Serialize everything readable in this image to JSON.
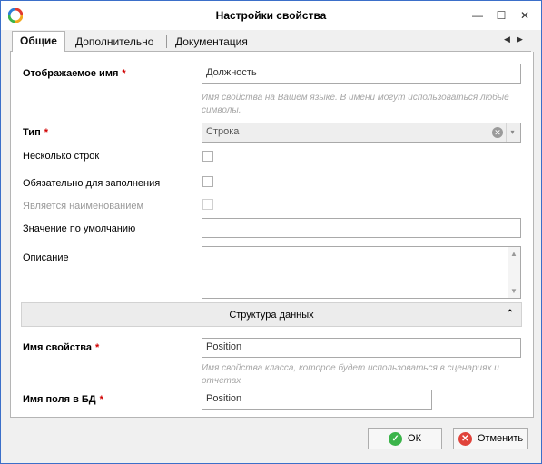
{
  "window": {
    "title": "Настройки свойства",
    "controls": {
      "minimize": "—",
      "maximize": "☐",
      "close": "✕"
    }
  },
  "tabs": [
    {
      "label": "Общие",
      "active": true
    },
    {
      "label": "Дополнительно",
      "active": false
    },
    {
      "label": "Документация",
      "active": false
    }
  ],
  "tab_nav": {
    "prev": "◀",
    "next": "▶"
  },
  "form": {
    "display_name": {
      "label": "Отображаемое имя",
      "required": "*",
      "value": "Должность",
      "hint": "Имя свойства на Вашем языке. В имени могут использоваться любые символы."
    },
    "type": {
      "label": "Тип",
      "required": "*",
      "value": "Строка",
      "clear_icon": "✕",
      "dropdown_icon": "▾"
    },
    "multiline": {
      "label": "Несколько строк",
      "checked": false
    },
    "required_field": {
      "label": "Обязательно для заполнения",
      "checked": false
    },
    "is_name": {
      "label": "Является наименованием",
      "checked": false,
      "disabled": true
    },
    "default_value": {
      "label": "Значение по умолчанию",
      "value": ""
    },
    "description": {
      "label": "Описание",
      "value": "",
      "scroll_up": "▲",
      "scroll_down": "▼"
    }
  },
  "data_structure": {
    "title": "Структура данных",
    "toggle_icon": "⌃",
    "property_name": {
      "label": "Имя свойства",
      "required": "*",
      "value": "Position",
      "hint": "Имя свойства класса, которое будет использоваться в сценариях и отчетах"
    },
    "db_field_name": {
      "label": "Имя поля в БД",
      "required": "*",
      "value": "Position"
    }
  },
  "buttons": {
    "ok": {
      "label": "ОК",
      "icon": "✓"
    },
    "cancel": {
      "label": "Отменить",
      "icon": "✕"
    }
  },
  "colors": {
    "accent": "#3b6fc9",
    "required": "#d00000",
    "ok": "#3bb44a",
    "cancel": "#e0433b"
  }
}
